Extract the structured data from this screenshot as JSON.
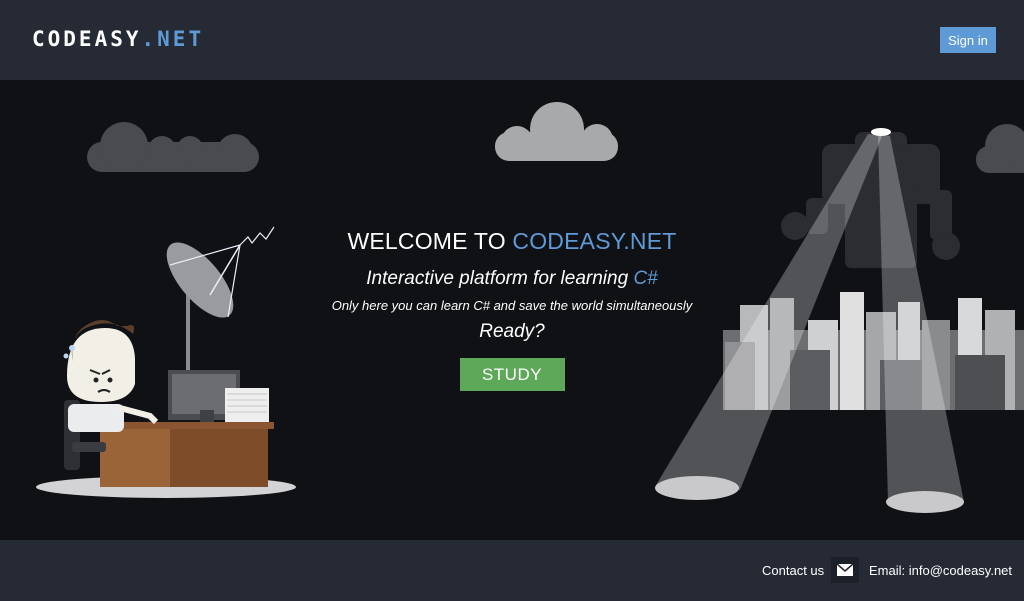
{
  "header": {
    "logo_main": "CODEASY",
    "logo_accent": ".NET",
    "signin_label": "Sign in"
  },
  "hero": {
    "welcome_prefix": "WELCOME TO ",
    "welcome_accent": "CODEASY.NET",
    "tagline_prefix": "Interactive platform for learning ",
    "tagline_accent": "C#",
    "subline": "Only here you can learn C# and save the world simultaneously",
    "ready": "Ready?",
    "study_label": "STUDY"
  },
  "footer": {
    "contact_label": "Contact us",
    "mail_icon": "envelope-icon",
    "email_text": "Email: info@codeasy.net"
  },
  "colors": {
    "accent": "#5e9ad6",
    "header_bg": "#252a35",
    "hero_bg": "#0f1115",
    "study_green": "#5ea85a"
  }
}
